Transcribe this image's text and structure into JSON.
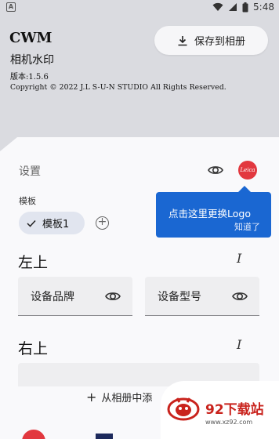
{
  "status_bar": {
    "time": "5:48",
    "badge": "A"
  },
  "header": {
    "app_name": "CWM",
    "subtitle": "相机水印",
    "version": "版本:1.5.6",
    "copyright": "Copyright © 2022 J.L S-U-N STUDIO All Rights Reserved.",
    "save_button": "保存到相册"
  },
  "settings": {
    "label": "设置",
    "logo_text": "Leica",
    "tooltip": {
      "text": "点击这里更换Logo",
      "dismiss": "知道了"
    }
  },
  "template": {
    "label": "模板",
    "selected_chip": "模板1",
    "add_symbol": "+"
  },
  "sections": {
    "top_left": {
      "title": "左上",
      "edit_icon": "I",
      "fields": [
        "设备品牌",
        "设备型号"
      ]
    },
    "top_right": {
      "title": "右上",
      "edit_icon": "I"
    }
  },
  "bottom": {
    "add_from_album": "从相册中添"
  },
  "watermark": {
    "text": "92下载站",
    "url": "www.xz92.com"
  },
  "colors": {
    "accent_blue": "#1a67d2",
    "brand_red": "#e2383f",
    "header_bg": "#dadbe0"
  }
}
